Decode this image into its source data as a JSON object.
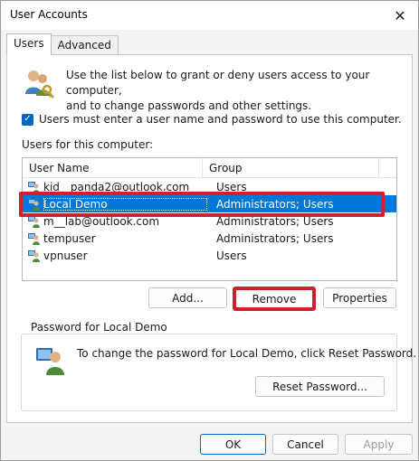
{
  "window": {
    "title": "User Accounts",
    "close_label": "✕"
  },
  "tabs": [
    {
      "label": "Users",
      "active": true
    },
    {
      "label": "Advanced",
      "active": false
    }
  ],
  "intro": {
    "line1": "Use the list below to grant or deny users access to your computer,",
    "line2": "and to change passwords and other settings."
  },
  "checkbox": {
    "checked": true,
    "label": "Users must enter a user name and password to use this computer."
  },
  "users_label": "Users for this computer:",
  "list": {
    "columns": [
      "User Name",
      "Group"
    ],
    "rows": [
      {
        "name": "kid__panda2@outlook.com",
        "group": "Users",
        "selected": false
      },
      {
        "name": "Local Demo",
        "group": "Administrators; Users",
        "selected": true
      },
      {
        "name": "m__lab@outlook.com",
        "group": "Administrators; Users",
        "selected": false
      },
      {
        "name": "tempuser",
        "group": "Administrators; Users",
        "selected": false
      },
      {
        "name": "vpnuser",
        "group": "Users",
        "selected": false
      }
    ]
  },
  "buttons": {
    "add": "Add...",
    "remove": "Remove",
    "properties": "Properties",
    "reset_password": "Reset Password...",
    "ok": "OK",
    "cancel": "Cancel",
    "apply": "Apply"
  },
  "password_group": {
    "legend": "Password for Local Demo",
    "text": "To change the password for Local Demo, click Reset Password."
  },
  "colors": {
    "selection": "#0078d7",
    "highlight": "#d0202c",
    "checkbox": "#0067c0"
  },
  "icons": {
    "intro": "users-key-icon",
    "row": "user-icon",
    "password": "user-password-icon"
  }
}
